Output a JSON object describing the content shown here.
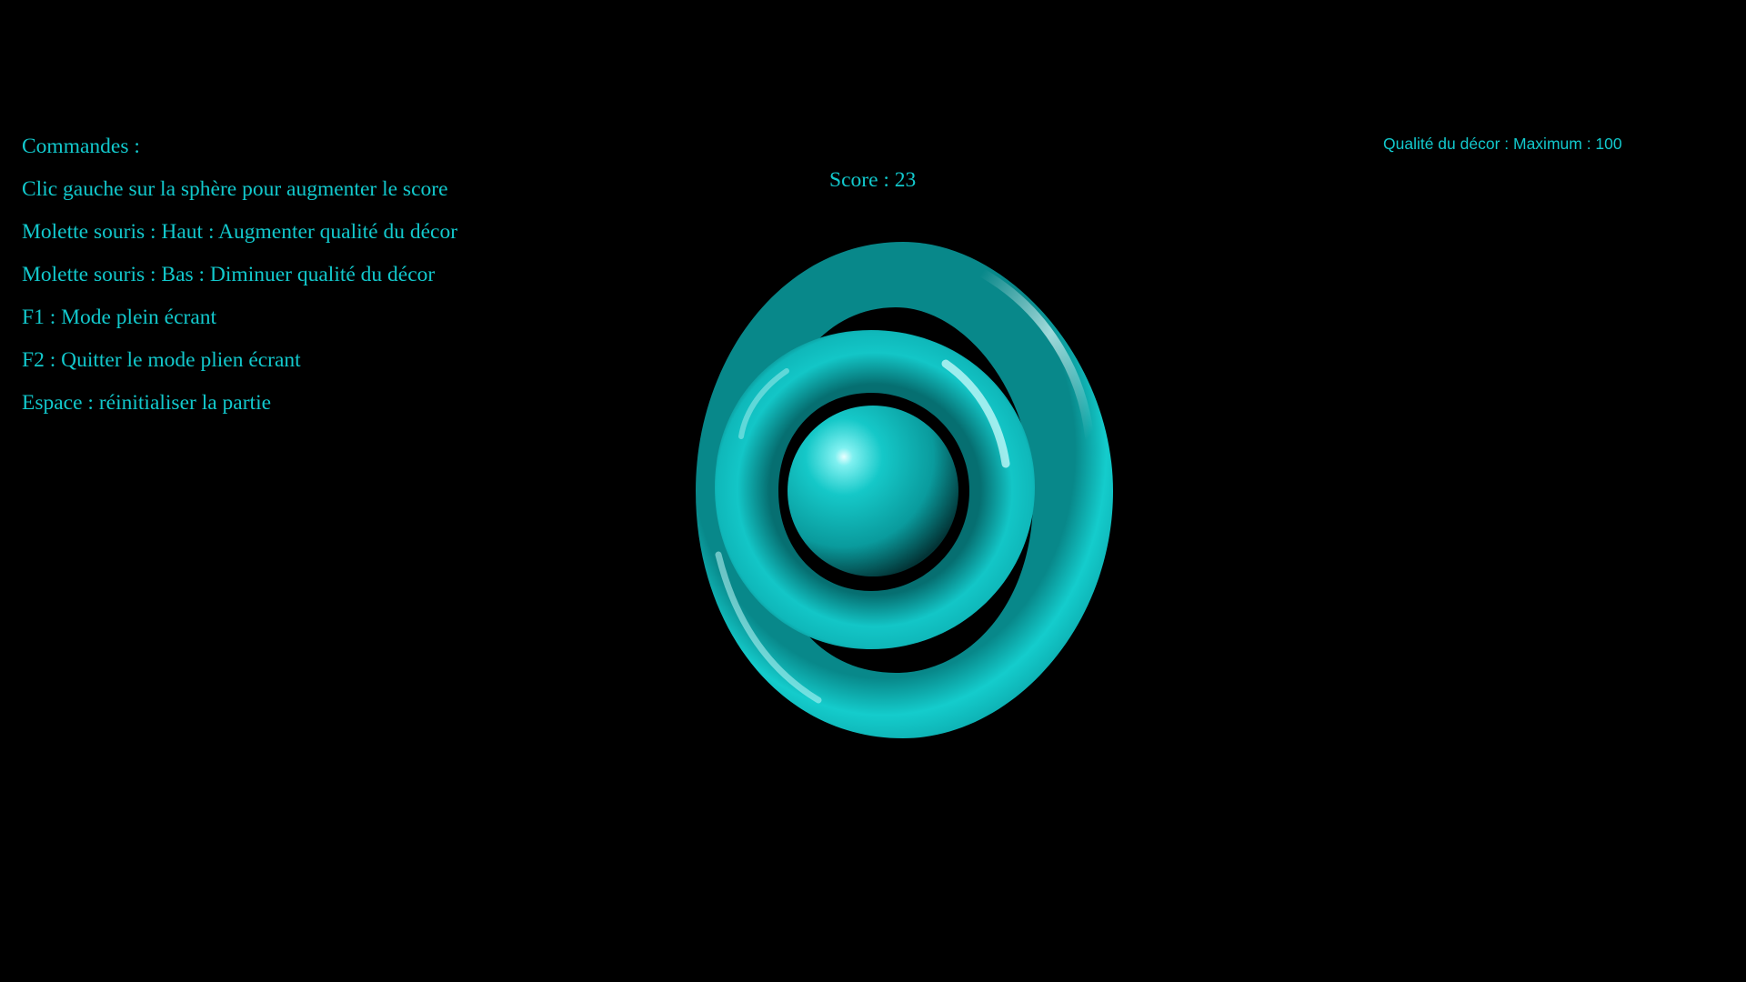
{
  "commands": {
    "title": "Commandes :",
    "lines": [
      "Clic gauche sur la sphère pour augmenter le score",
      "Molette souris : Haut : Augmenter qualité du décor",
      "Molette souris : Bas : Diminuer qualité du décor",
      "F1 : Mode plein écrant",
      "F2 : Quitter le mode plien écrant",
      "Espace : réinitialiser la partie"
    ]
  },
  "score": {
    "label": "Score : 23",
    "value": 23
  },
  "quality": {
    "label": "Qualité du décor : Maximum : 100",
    "value": 100
  },
  "colors": {
    "text": "#12c8cc",
    "object": "#0fc9c9",
    "background": "#000000"
  }
}
